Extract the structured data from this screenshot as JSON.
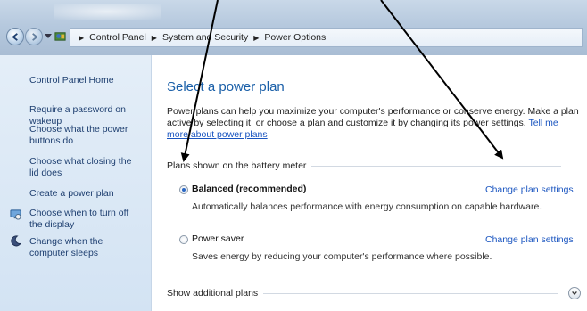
{
  "addressbar": {
    "breadcrumbs": [
      "Control Panel",
      "System and Security",
      "Power Options"
    ]
  },
  "leftpane": {
    "items": [
      {
        "label": "Control Panel Home",
        "icon": ""
      },
      {
        "label": "Require a password on wakeup",
        "icon": ""
      },
      {
        "label": "Choose what the power buttons do",
        "icon": ""
      },
      {
        "label": "Choose what closing the lid does",
        "icon": ""
      },
      {
        "label": "Create a power plan",
        "icon": ""
      },
      {
        "label": "Choose when to turn off the display",
        "icon": "display-icon"
      },
      {
        "label": "Change when the computer sleeps",
        "icon": "moon-icon"
      }
    ]
  },
  "main": {
    "title": "Select a power plan",
    "description": "Power plans can help you maximize your computer's performance or conserve energy. Make a plan active by selecting it, or choose a plan and customize it by changing its power settings. ",
    "description_link": "Tell me more about power plans",
    "section_battery": "Plans shown on the battery meter",
    "plans": [
      {
        "name": "Balanced (recommended)",
        "description": "Automatically balances performance with energy consumption on capable hardware.",
        "link": "Change plan settings",
        "selected": true
      },
      {
        "name": "Power saver",
        "description": "Saves energy by reducing your computer's performance where possible.",
        "link": "Change plan settings",
        "selected": false
      }
    ],
    "section_additional": "Show additional plans"
  },
  "colors": {
    "title_blue": "#1a5fa8",
    "link_blue": "#1a55c0",
    "nav_link": "#1e3f70",
    "left_pane_bg": "#d3e3f3"
  }
}
